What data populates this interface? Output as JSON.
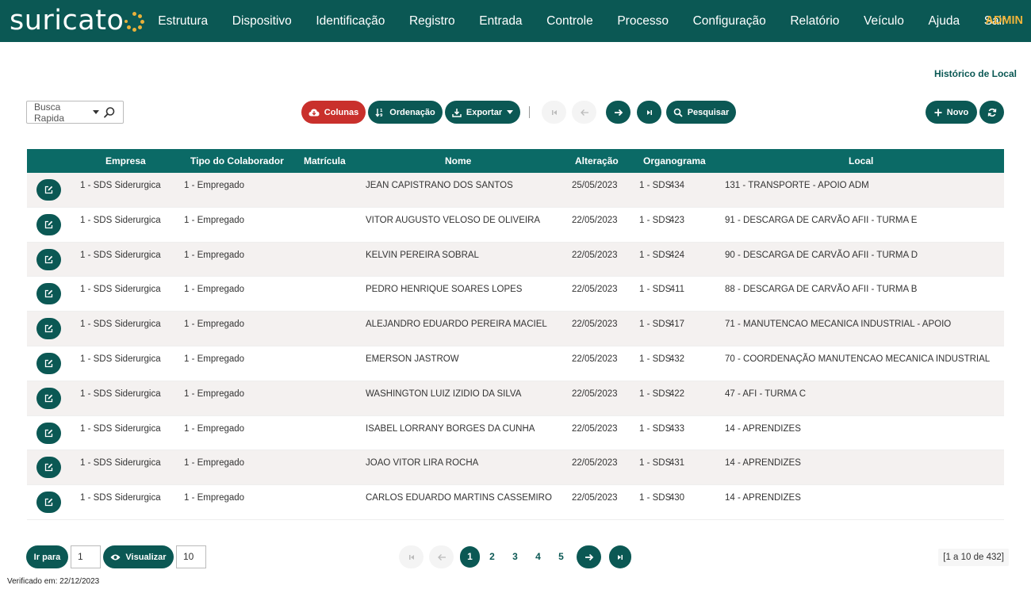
{
  "app": {
    "logo_text": "suricato",
    "user": "ADMIN",
    "brand_color": "#0b5854",
    "accent_color": "#f0b43a"
  },
  "nav": [
    "Estrutura",
    "Dispositivo",
    "Identificação",
    "Registro",
    "Entrada",
    "Controle",
    "Processo",
    "Configuração",
    "Relatório",
    "Veículo",
    "Ajuda",
    "Sair"
  ],
  "page": {
    "title_link": "Histórico de Local"
  },
  "search": {
    "label": "Busca Rapida",
    "icon": "search-icon"
  },
  "toolbar": {
    "columns": "Colunas",
    "ordering": "Ordenação",
    "export": "Exportar",
    "search": "Pesquisar",
    "new": "Novo"
  },
  "table": {
    "headers": [
      "Empresa",
      "Tipo do Colaborador",
      "Matrícula",
      "Nome",
      "Alteração",
      "Organograma",
      "Local"
    ],
    "rows": [
      {
        "empresa": "1 - SDS Siderurgica",
        "tipo": "1 - Empregado",
        "matricula": "434",
        "nome": "JEAN CAPISTRANO DOS SANTOS",
        "alteracao": "25/05/2023",
        "organograma": "1 - SDS",
        "local": "131 - TRANSPORTE - APOIO ADM"
      },
      {
        "empresa": "1 - SDS Siderurgica",
        "tipo": "1 - Empregado",
        "matricula": "423",
        "nome": "VITOR AUGUSTO VELOSO DE OLIVEIRA",
        "alteracao": "22/05/2023",
        "organograma": "1 - SDS",
        "local": "91 - DESCARGA DE CARVÃO AFII - TURMA E"
      },
      {
        "empresa": "1 - SDS Siderurgica",
        "tipo": "1 - Empregado",
        "matricula": "424",
        "nome": "KELVIN PEREIRA SOBRAL",
        "alteracao": "22/05/2023",
        "organograma": "1 - SDS",
        "local": "90 - DESCARGA DE CARVÃO AFII - TURMA D"
      },
      {
        "empresa": "1 - SDS Siderurgica",
        "tipo": "1 - Empregado",
        "matricula": "411",
        "nome": "PEDRO HENRIQUE SOARES LOPES",
        "alteracao": "22/05/2023",
        "organograma": "1 - SDS",
        "local": "88 - DESCARGA DE CARVÃO AFII - TURMA B"
      },
      {
        "empresa": "1 - SDS Siderurgica",
        "tipo": "1 - Empregado",
        "matricula": "417",
        "nome": "ALEJANDRO EDUARDO PEREIRA MACIEL",
        "alteracao": "22/05/2023",
        "organograma": "1 - SDS",
        "local": "71 - MANUTENCAO MECANICA INDUSTRIAL - APOIO"
      },
      {
        "empresa": "1 - SDS Siderurgica",
        "tipo": "1 - Empregado",
        "matricula": "432",
        "nome": "EMERSON JASTROW",
        "alteracao": "22/05/2023",
        "organograma": "1 - SDS",
        "local": "70 - COORDENAÇÃO MANUTENCAO MECANICA INDUSTRIAL"
      },
      {
        "empresa": "1 - SDS Siderurgica",
        "tipo": "1 - Empregado",
        "matricula": "422",
        "nome": "WASHINGTON LUIZ IZIDIO DA SILVA",
        "alteracao": "22/05/2023",
        "organograma": "1 - SDS",
        "local": "47 - AFI - TURMA C"
      },
      {
        "empresa": "1 - SDS Siderurgica",
        "tipo": "1 - Empregado",
        "matricula": "433",
        "nome": "ISABEL LORRANY BORGES DA CUNHA",
        "alteracao": "22/05/2023",
        "organograma": "1 - SDS",
        "local": "14 - APRENDIZES"
      },
      {
        "empresa": "1 - SDS Siderurgica",
        "tipo": "1 - Empregado",
        "matricula": "431",
        "nome": "JOAO VITOR LIRA ROCHA",
        "alteracao": "22/05/2023",
        "organograma": "1 - SDS",
        "local": "14 - APRENDIZES"
      },
      {
        "empresa": "1 - SDS Siderurgica",
        "tipo": "1 - Empregado",
        "matricula": "430",
        "nome": "CARLOS EDUARDO MARTINS CASSEMIRO",
        "alteracao": "22/05/2023",
        "organograma": "1 - SDS",
        "local": "14 - APRENDIZES"
      }
    ]
  },
  "footer": {
    "goto_label": "Ir para",
    "goto_value": "1",
    "view_label": "Visualizar",
    "view_value": "10",
    "pages": [
      "1",
      "2",
      "3",
      "4",
      "5"
    ],
    "current_page": "1",
    "range_text": "[1 a 10 de 432]",
    "verified": "Verificado em: 22/12/2023"
  }
}
